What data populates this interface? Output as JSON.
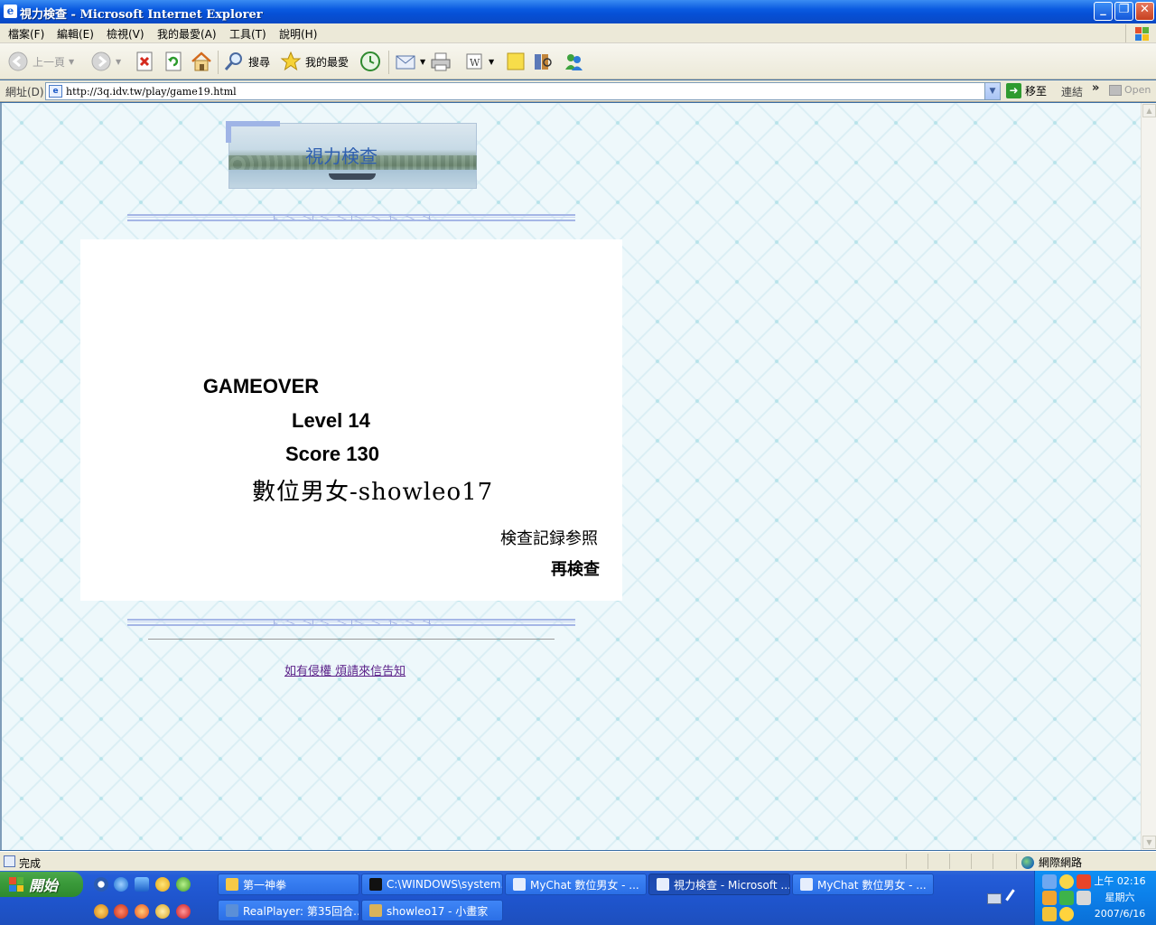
{
  "window": {
    "title": "視力検查 - Microsoft Internet Explorer",
    "minimize": "_",
    "maximize": "❐",
    "close": "✕"
  },
  "menu": [
    "檔案(F)",
    "編輯(E)",
    "檢視(V)",
    "我的最愛(A)",
    "工具(T)",
    "說明(H)"
  ],
  "toolbar": {
    "back": "上一頁",
    "search": "搜尋",
    "favorites": "我的最愛"
  },
  "address": {
    "label": "網址(D)",
    "url": "http://3q.idv.tw/play/game19.html",
    "go": "移至",
    "links": "連結",
    "links_more": "»",
    "open": "Open"
  },
  "page": {
    "banner_title": "視力検查",
    "gameover": "GAMEOVER",
    "level_label": "Level",
    "level": "14",
    "score_label": "Score",
    "score": "130",
    "player": "數位男女-showleo17",
    "history_link": "検查記録参照",
    "retry_link": "再検查",
    "footer_link": "如有侵權 煩請來信告知"
  },
  "status": {
    "text": "完成",
    "zone": "網際網路"
  },
  "taskbar": {
    "start": "開始",
    "tasks_row1": [
      {
        "label": "第一神拳",
        "color": "#f7c948"
      },
      {
        "label": "C:\\WINDOWS\\system...",
        "color": "#111111"
      },
      {
        "label": "MyChat 數位男女 - ...",
        "color": "#e6eefc"
      },
      {
        "label": "視力検查 - Microsoft ...",
        "color": "#e6eefc",
        "active": true
      },
      {
        "label": "MyChat 數位男女 - ...",
        "color": "#e6eefc"
      }
    ],
    "tasks_row2": [
      {
        "label": "RealPlayer: 第35回合...",
        "color": "#5a8fd8"
      },
      {
        "label": "showleo17 - 小畫家",
        "color": "#d9b35a"
      }
    ],
    "clock_time": "上午 02:16",
    "clock_day": "星期六",
    "clock_date": "2007/6/16"
  },
  "colors": {
    "xp_blue": "#0a5ae0",
    "start_green": "#3b9b3b",
    "banner_text": "#2e5fb0",
    "footer_link": "#5a1f88"
  },
  "icons": [
    "ie-page-icon",
    "back-icon",
    "forward-icon",
    "stop-icon",
    "refresh-icon",
    "home-icon",
    "search-icon",
    "favorites-star-icon",
    "history-icon",
    "mail-icon",
    "print-icon",
    "edit-icon",
    "discuss-icon",
    "research-icon",
    "messenger-icon",
    "go-arrow-icon",
    "globe-icon",
    "windows-flag-icon"
  ]
}
